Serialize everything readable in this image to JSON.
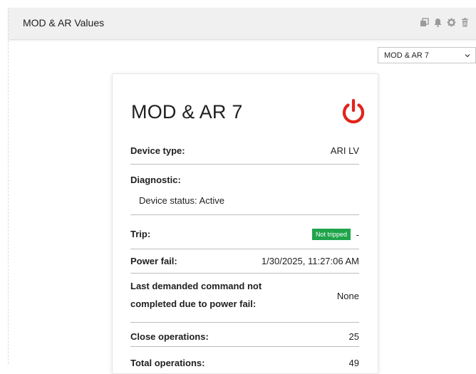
{
  "panel": {
    "title": "MOD & AR Values",
    "icons": [
      "copy-icon",
      "bell-icon",
      "gear-icon",
      "trash-icon"
    ]
  },
  "device_select": {
    "selected": "MOD & AR 7"
  },
  "card": {
    "title": "MOD & AR 7",
    "status_icon": "power-icon",
    "status_color": "#e2231a",
    "rows": {
      "device_type": {
        "label": "Device type:",
        "value": "ARI LV"
      },
      "diagnostic": {
        "label": "Diagnostic:",
        "value": "Device status: Active"
      },
      "trip": {
        "label": "Trip:",
        "badge": "Not tripped",
        "badge_color": "#1ea44a",
        "value": "-"
      },
      "power_fail": {
        "label": "Power fail:",
        "value": "1/30/2025, 11:27:06 AM"
      },
      "last_cmd": {
        "label_line1": "Last demanded command not",
        "label_line2": "completed due to power fail:",
        "value": "None"
      },
      "close_ops": {
        "label": "Close operations:",
        "value": "25"
      },
      "total_ops": {
        "label": "Total operations:",
        "value": "49"
      }
    }
  }
}
